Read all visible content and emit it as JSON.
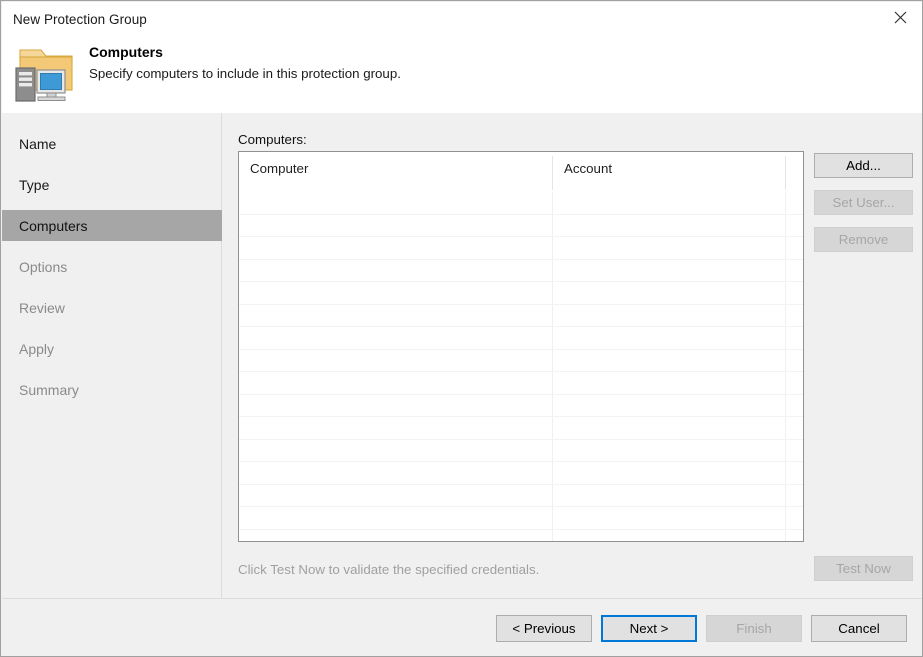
{
  "window": {
    "title": "New Protection Group",
    "close_icon": "close-icon"
  },
  "header": {
    "icon": "protection-group-folder-computer-icon",
    "title": "Computers",
    "subtitle": "Specify computers to include in this protection group."
  },
  "sidebar": {
    "items": [
      {
        "label": "Name",
        "state": "done"
      },
      {
        "label": "Type",
        "state": "done"
      },
      {
        "label": "Computers",
        "state": "active"
      },
      {
        "label": "Options",
        "state": "pending"
      },
      {
        "label": "Review",
        "state": "pending"
      },
      {
        "label": "Apply",
        "state": "pending"
      },
      {
        "label": "Summary",
        "state": "pending"
      }
    ]
  },
  "main": {
    "list_label": "Computers:",
    "columns": [
      "Computer",
      "Account",
      ""
    ],
    "rows": [],
    "row_count": 16,
    "side_buttons": [
      {
        "label": "Add...",
        "enabled": true
      },
      {
        "label": "Set User...",
        "enabled": false
      },
      {
        "label": "Remove",
        "enabled": false
      }
    ],
    "hint": "Click Test Now to validate the specified credentials.",
    "test_now_label": "Test Now",
    "test_now_enabled": false
  },
  "footer": {
    "previous_label": "< Previous",
    "next_label": "Next >",
    "finish_label": "Finish",
    "cancel_label": "Cancel",
    "focused_button": "Next >",
    "finish_enabled": false
  },
  "colors": {
    "dialog_background": "#f0f0f0",
    "titlebar_background": "#ffffff",
    "active_nav_background": "#a6a6a6",
    "focus_accent": "#0078d7",
    "disabled_text": "#a6a6a6",
    "folder_icon": "#f2c66b",
    "monitor_icon": "#3d9ad6",
    "tower_icon": "#808080"
  }
}
